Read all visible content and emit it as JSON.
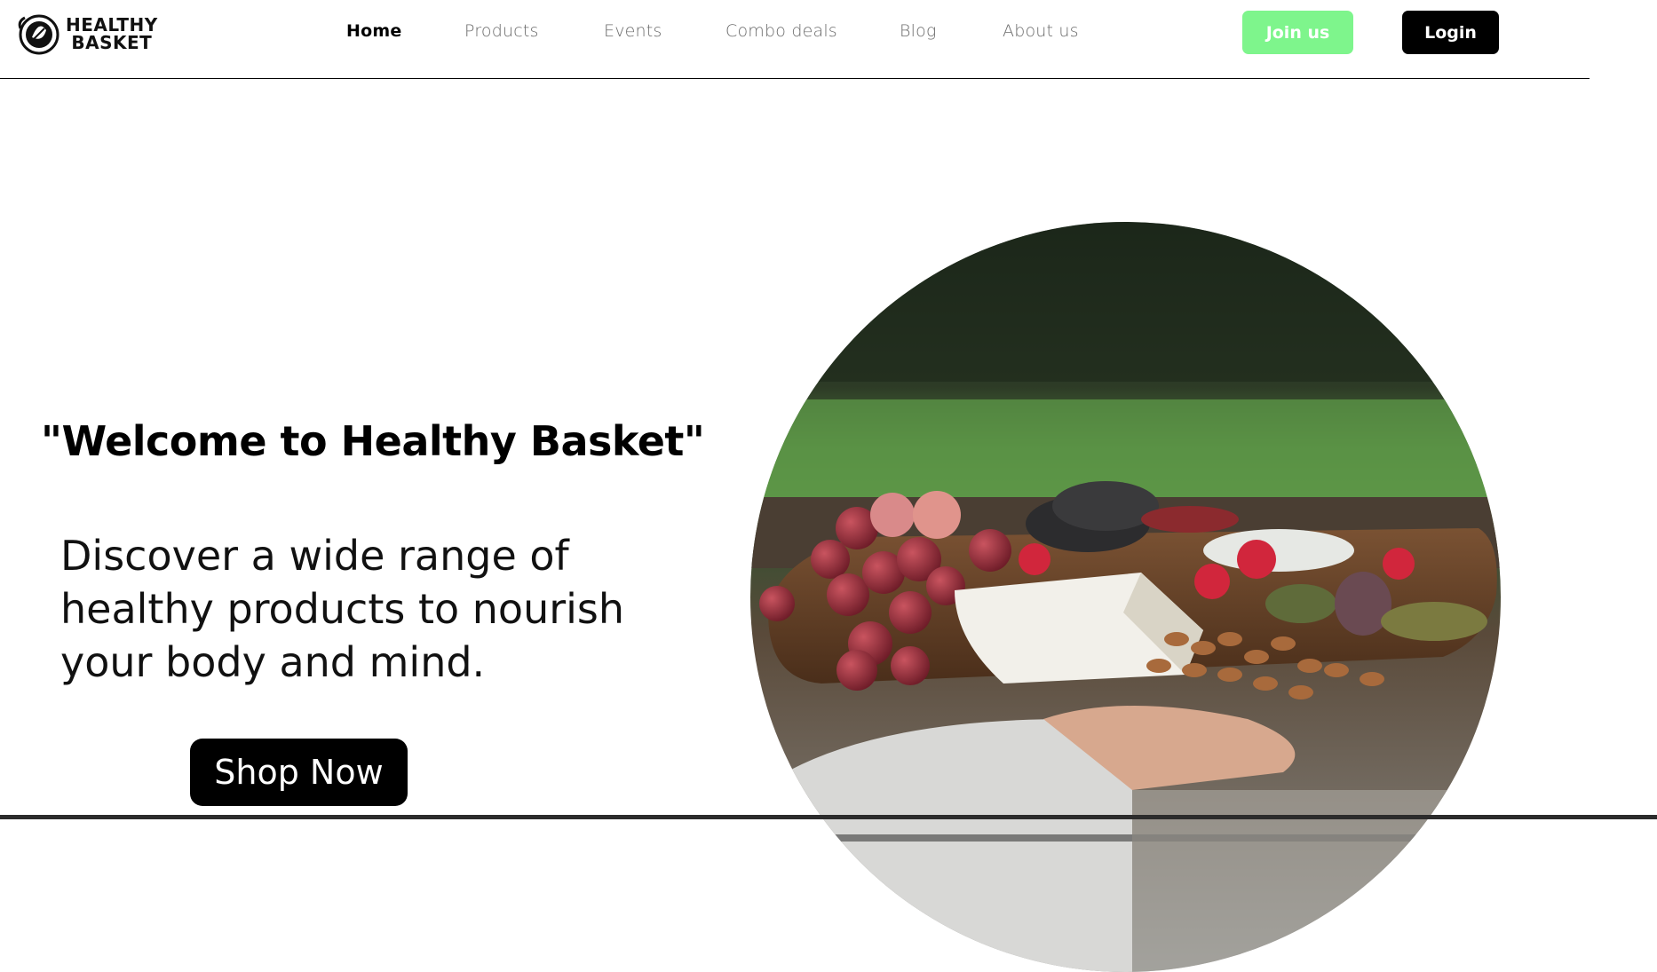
{
  "brand": {
    "name_line1": "HEALTHY",
    "name_line2": "BASKET",
    "logo_icon": "leaf-basket-icon"
  },
  "nav": {
    "items": [
      {
        "label": "Home",
        "active": true
      },
      {
        "label": "Products",
        "active": false
      },
      {
        "label": "Events",
        "active": false
      },
      {
        "label": "Combo deals",
        "active": false
      },
      {
        "label": "Blog",
        "active": false
      },
      {
        "label": "About us",
        "active": false
      }
    ],
    "join_label": "Join us",
    "login_label": "Login"
  },
  "hero": {
    "title": "\"Welcome to Healthy Basket\"",
    "description": "Discover a wide range of healthy products to nourish your body and mind.",
    "cta_label": "Shop Now",
    "image_icon": "cheese-platter-photo"
  },
  "colors": {
    "accent_green": "#7ef58c",
    "primary_black": "#000000",
    "nav_inactive": "#6b6b6b"
  }
}
